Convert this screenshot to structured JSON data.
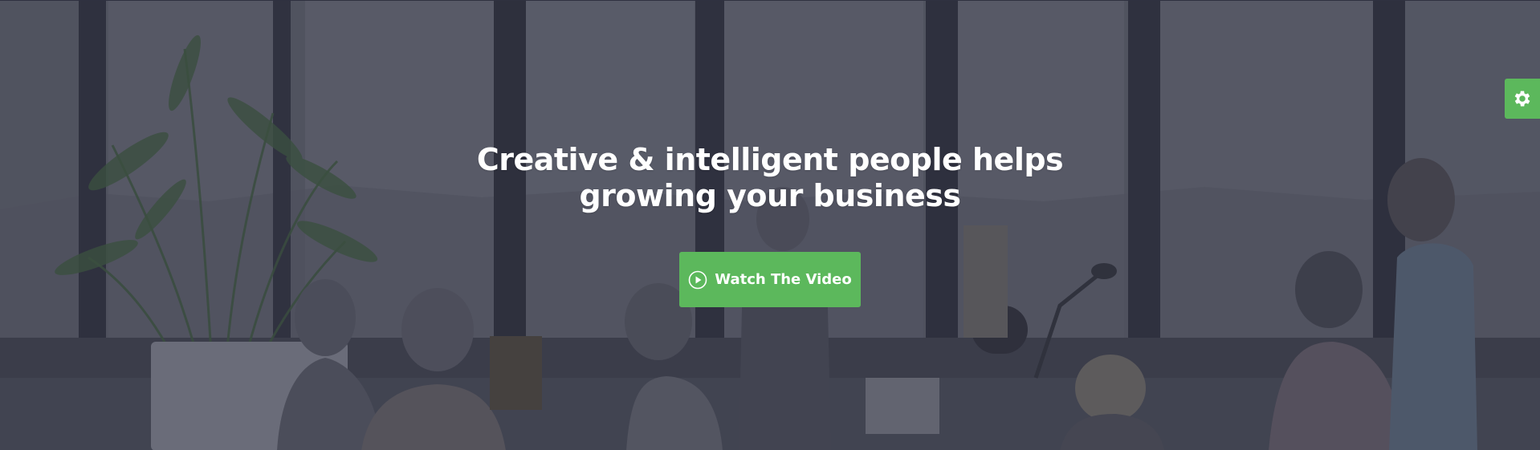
{
  "hero": {
    "headline_line1": "Creative & intelligent people helps",
    "headline_line2": "growing your business",
    "cta_label": "Watch The Video"
  },
  "icons": {
    "cta_icon": "play-circle-icon",
    "settings_icon": "gear-icon"
  },
  "colors": {
    "accent": "#5cb85c",
    "overlay": "#3f4151",
    "text": "#ffffff"
  }
}
